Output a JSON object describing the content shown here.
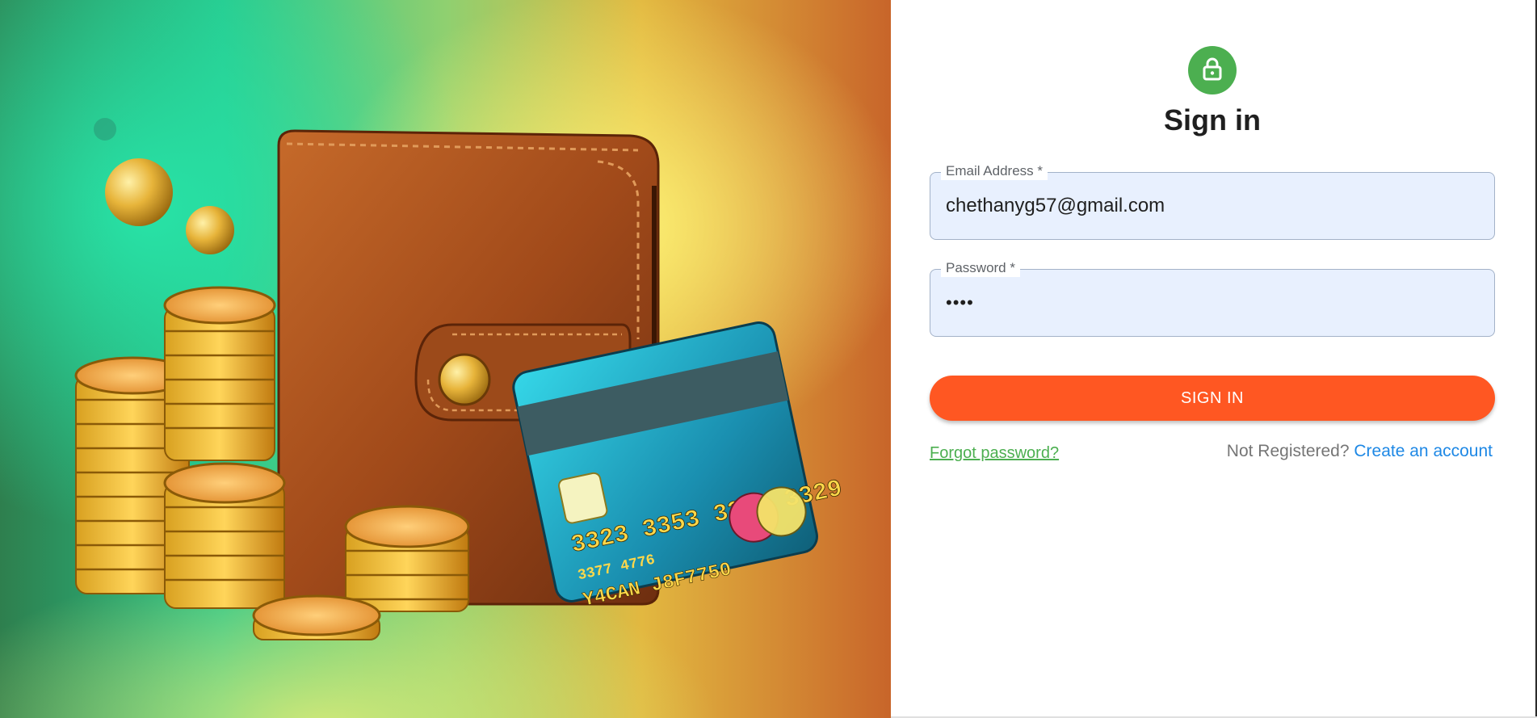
{
  "signin": {
    "title": "Sign in",
    "email": {
      "label": "Email Address *",
      "value": "chethanyg57@gmail.com"
    },
    "password": {
      "label": "Password *",
      "value": "••••"
    },
    "submit_label": "SIGN IN",
    "forgot_label": "Forgot password?",
    "register_prompt": "Not Registered?",
    "register_link": "Create an account"
  },
  "icons": {
    "lock": "lock-icon"
  },
  "colors": {
    "primary_green": "#4caf50",
    "button_orange": "#ff5722",
    "link_blue": "#1e88e5",
    "field_bg": "#e8f0fe"
  },
  "hero": {
    "card_text": {
      "number": "3323 3353 3363 3329",
      "sub": "3377 4776",
      "name": "Y4CAN J8F7750"
    }
  }
}
